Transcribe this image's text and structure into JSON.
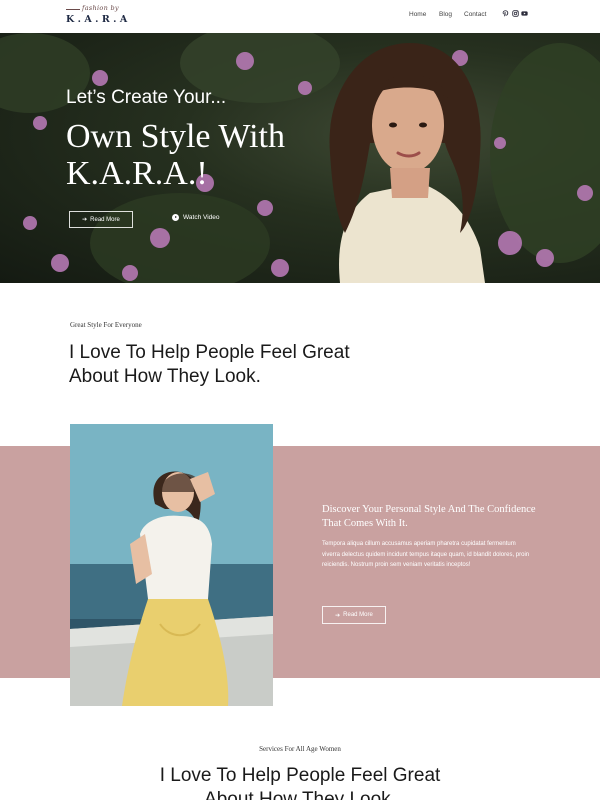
{
  "header": {
    "logo_script": "fashion by",
    "logo_word": "K.A.R.A",
    "nav": [
      "Home",
      "Blog",
      "Contact"
    ],
    "social_icons": [
      "pinterest-icon",
      "instagram-icon",
      "youtube-icon"
    ]
  },
  "hero": {
    "kicker": "Let’s Create Your...",
    "title": "Own Style With K.A.R.A.!",
    "read_more_label": "Read More",
    "watch_video_label": "Watch Video"
  },
  "intro": {
    "eyebrow": "Great Style For Everyone",
    "heading": "I Love To Help People Feel Great About How They Look."
  },
  "feature": {
    "heading": "Discover Your Personal Style And The Confidence That Comes With It.",
    "body": "Tempora aliqua cillum accusamus aperiam pharetra cupidatat fermentum viverra delectus quidem incidunt tempus itaque quam, id blandit dolores, proin reiciendis. Nostrum proin sem veniam veritatis inceptos!",
    "read_more_label": "Read More"
  },
  "services": {
    "eyebrow": "Services For All Age Women",
    "heading": "I Love To Help People Feel Great About How They Look."
  },
  "colors": {
    "band": "#c9a1a0",
    "nav_dark": "#1f2a44"
  }
}
